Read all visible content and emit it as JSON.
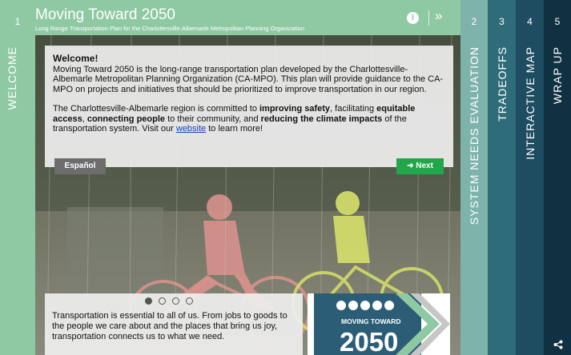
{
  "sections": {
    "welcome": {
      "num": "1",
      "label": "WELCOME"
    },
    "tabs": [
      {
        "num": "2",
        "label": "SYSTEM NEEDS EVALUATION"
      },
      {
        "num": "3",
        "label": "TRADEOFFS"
      },
      {
        "num": "4",
        "label": "INTERACTIVE MAP"
      },
      {
        "num": "5",
        "label": "WRAP UP"
      }
    ]
  },
  "header": {
    "title": "Moving Toward 2050",
    "subtitle": "Long Range Transportation Plan for the Charlottesville-Albemarle Metropolitan Planning Organization",
    "info_icon": "i",
    "next_icon": "»"
  },
  "welcome_card": {
    "heading": "Welcome!",
    "para1": "Moving Toward 2050 is the long-range transportation plan developed by the Charlottesville-Albemarle Metropolitan Planning Organization (CA-MPO). This plan will provide guidance to the CA-MPO on projects and initiatives that should be prioritized to improve transportation in our region.",
    "p2_a": "The Charlottesville-Albemarle region is committed to ",
    "p2_b": "improving safety",
    "p2_c": ", facilitating ",
    "p2_d": "equitable access",
    "p2_e": ", ",
    "p2_f": "connecting people",
    "p2_g": " to their community, and ",
    "p2_h": "reducing the climate impacts",
    "p2_i": " of the transportation system. Visit our ",
    "p2_link": "website",
    "p2_j": " to learn more!",
    "espanol_button": "Español",
    "next_button": "➜ Next"
  },
  "carousel": {
    "active_index": 0,
    "count": 4,
    "caption": "Transportation is essential to all of us. From jobs to goods to the people we care about and the places that bring us joy, transportation connects us to what we need."
  },
  "logo": {
    "line1": "MOVING TOWARD",
    "line2": "2050"
  },
  "colors": {
    "welcome_green": "#8fc9a4",
    "tab2": "#7eb3ac",
    "tab3": "#2f6c7a",
    "tab4": "#1e4c61",
    "tab5": "#0f3142",
    "next_button": "#22a64a",
    "espanol_button": "#6d6d6d"
  },
  "icons": {
    "info": "info-icon",
    "next": "double-chevron-right-icon",
    "share": "share-icon"
  }
}
